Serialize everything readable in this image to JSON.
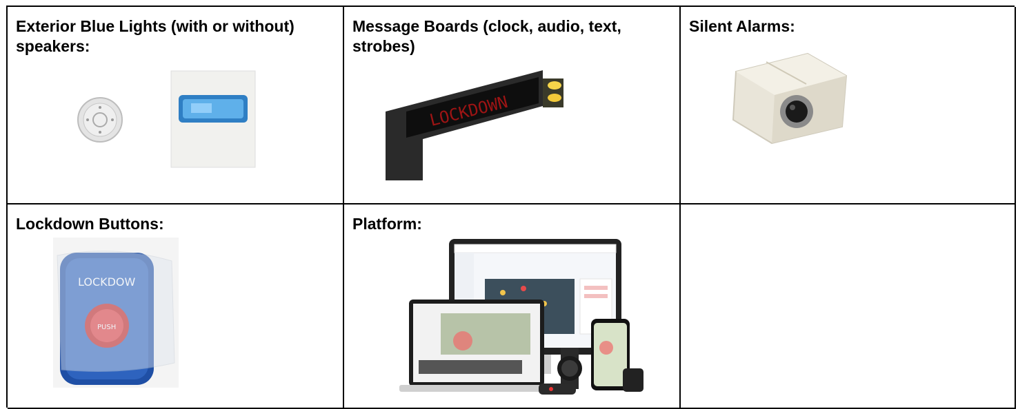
{
  "cells": [
    {
      "title": "Exterior Blue Lights (with or without) speakers:",
      "icons": [
        "round-speaker-icon",
        "blue-light-strobe-icon"
      ]
    },
    {
      "title": "Message Boards (clock, audio, text, strobes)",
      "sign_text": "LOCKDOWN",
      "icons": [
        "message-board-icon"
      ]
    },
    {
      "title": "Silent Alarms:",
      "icons": [
        "silent-alarm-icon"
      ]
    },
    {
      "title": "Lockdown Buttons:",
      "button_text": "LOCKDOW",
      "push_text": "PUSH",
      "icons": [
        "lockdown-button-icon"
      ]
    },
    {
      "title": "Platform:",
      "icons": [
        "laptop-icon",
        "monitor-icon",
        "phone-icon",
        "watch-icon"
      ]
    },
    {
      "title": ""
    }
  ]
}
